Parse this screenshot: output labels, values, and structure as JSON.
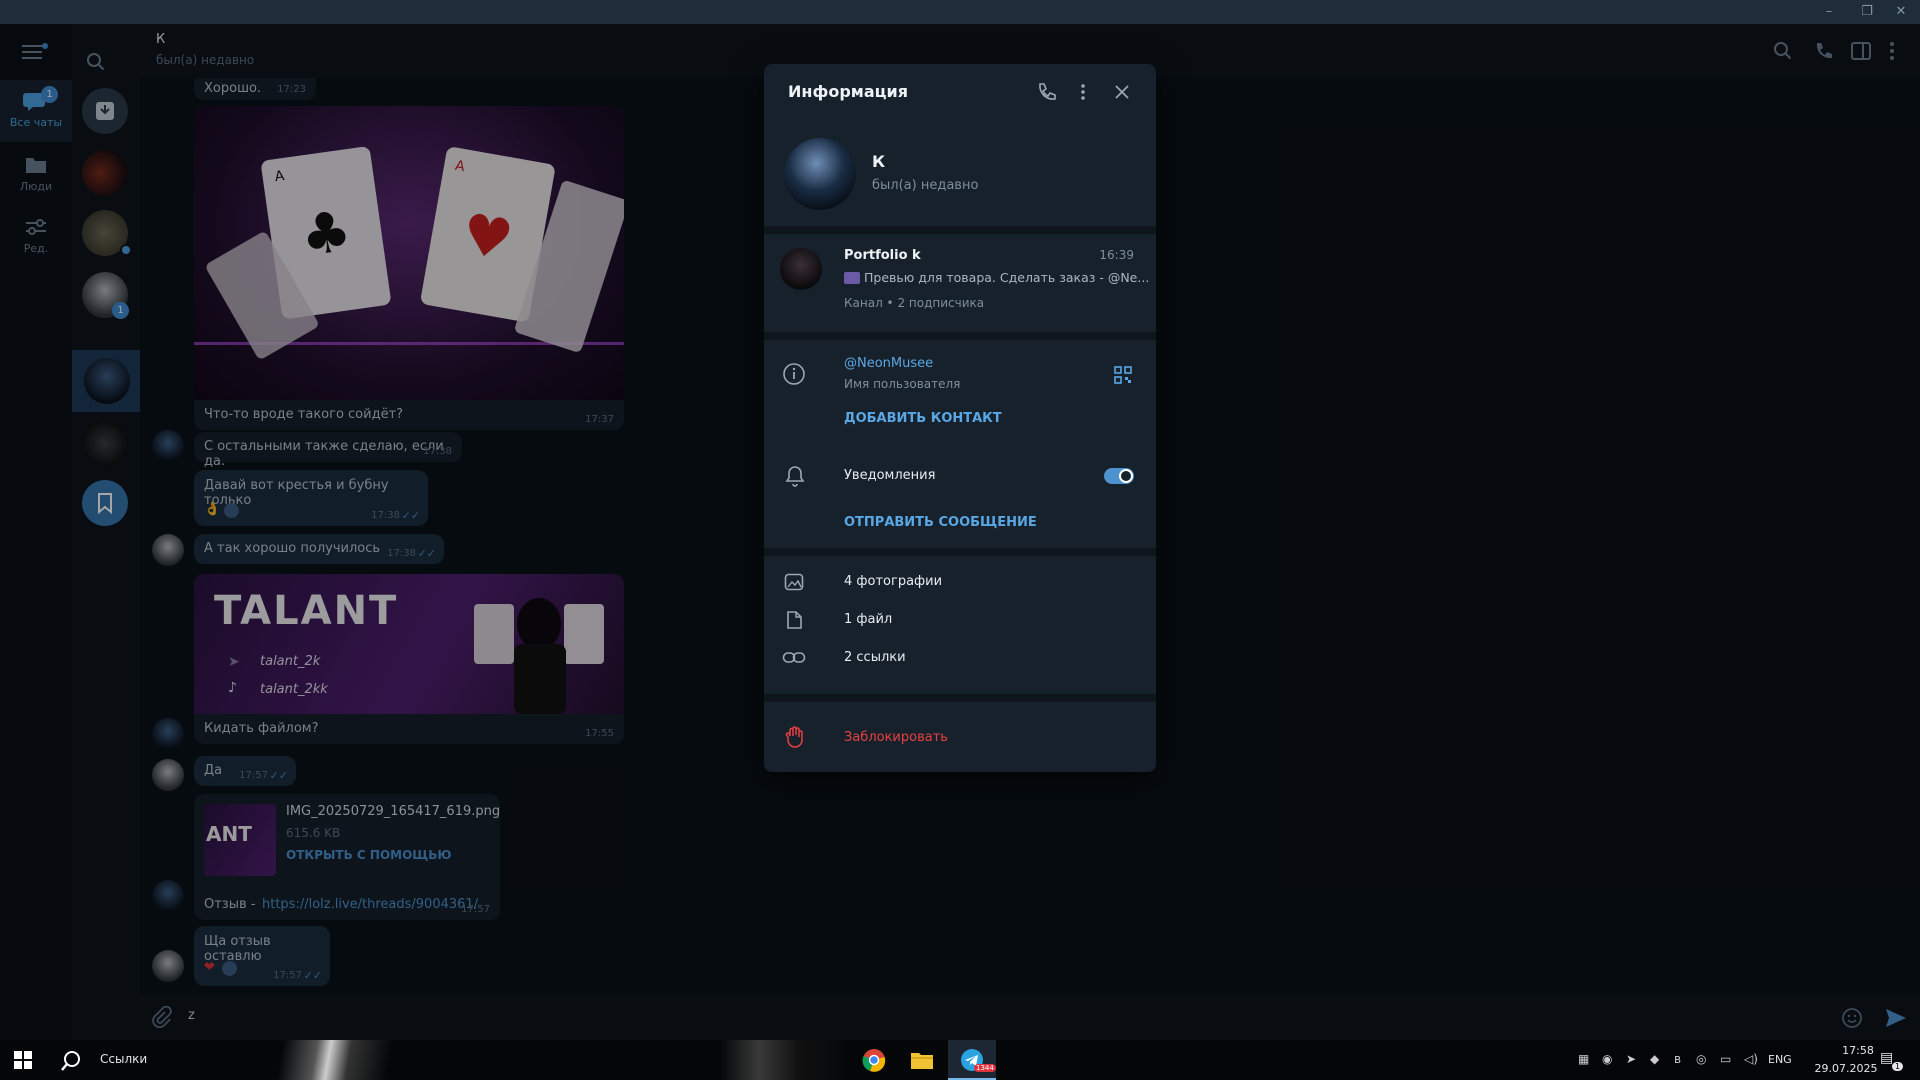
{
  "window": {
    "minimize": "–",
    "restore": "❐",
    "close": "✕"
  },
  "nav": {
    "all_chats": "Все чаты",
    "all_chats_badge": "1",
    "people": "Люди",
    "edit": "Ред."
  },
  "chatlist": {
    "badge_third": "1"
  },
  "header": {
    "title": "К",
    "status": "был(а) недавно"
  },
  "messages": [
    {
      "text": "Хорошо.",
      "time": "17:23"
    },
    {
      "text": "Что-то вроде такого сойдёт?",
      "time": "17:37"
    },
    {
      "text": "С остальными также сделаю, если да.",
      "time": "17:38"
    },
    {
      "text": "Давай вот крестья и бубну только",
      "time": "17:38"
    },
    {
      "text": "А так хорошо получилось",
      "time": "17:38"
    },
    {
      "text": "Кидать файлом?",
      "time": "17:55"
    },
    {
      "text": "Да",
      "time": "17:57"
    },
    {
      "text": "Отзыв - ",
      "link": "https://lolz.live/threads/9004361/",
      "time": "17:57"
    },
    {
      "text": "Ща отзыв оставлю",
      "time": "17:57"
    }
  ],
  "banner": {
    "title": "TALANT",
    "line1": "talant_2k",
    "line2": "talant_2kk",
    "thumb_text": "ANT"
  },
  "file": {
    "name": "IMG_20250729_165417_619.png",
    "size": "615.6 KB",
    "action": "ОТКРЫТЬ С ПОМОЩЬЮ"
  },
  "composer": {
    "value": "z"
  },
  "panel": {
    "title": "Информация",
    "name": "К",
    "status": "был(а) недавно",
    "channel": {
      "name": "Portfolio k",
      "time": "16:39",
      "preview": "Превью для товара. Сделать заказ - @Ne...",
      "meta": "Канал • 2 подписчика"
    },
    "username": "@NeonMusee",
    "username_label": "Имя пользователя",
    "add_contact": "ДОБАВИТЬ КОНТАКТ",
    "notifications": "Уведомления",
    "notifications_on": true,
    "send_message": "ОТПРАВИТЬ СООБЩЕНИЕ",
    "photos": "4 фотографии",
    "files": "1 файл",
    "links": "2 ссылки",
    "block": "Заблокировать"
  },
  "taskbar": {
    "search": "Ссылки",
    "lang": "ENG",
    "time": "17:58",
    "date": "29.07.2025",
    "tg_badge": "1344",
    "notif": "1"
  },
  "colors": {
    "accent": "#5aa7e6",
    "danger": "#e8403f",
    "panel": "#17212b"
  }
}
